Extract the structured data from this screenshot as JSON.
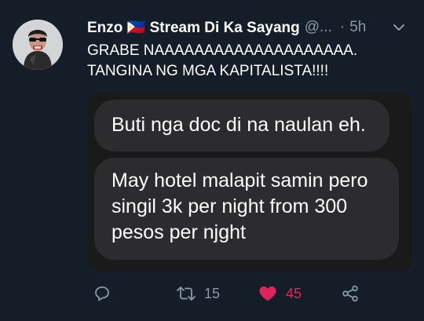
{
  "tweet": {
    "author_name": "Enzo 🇵🇭 Stream Di Ka Sayang",
    "handle": "@...",
    "separator": "·",
    "time": "5h",
    "text_lines": [
      "GRABE NAAAAAAAAAAAAAAAAAAAA.",
      "TANGINA NG MGA KAPITALISTA!!!!"
    ]
  },
  "media": {
    "bubble1": "Buti nga doc di na naulan eh.",
    "bubble2_lines": [
      "May hotel malapit samin pero",
      "singil 3k per night from 300",
      "pesos per njght"
    ]
  },
  "actions": {
    "reply_icon": "reply-icon",
    "retweet_icon": "retweet-icon",
    "retweet_count": "15",
    "like_icon": "heart-icon",
    "like_count": "45",
    "share_icon": "share-icon"
  },
  "colors": {
    "background": "#151d28",
    "secondary_text": "#8899a6",
    "like_color": "#e0245e",
    "bubble": "#2c2c2e"
  }
}
